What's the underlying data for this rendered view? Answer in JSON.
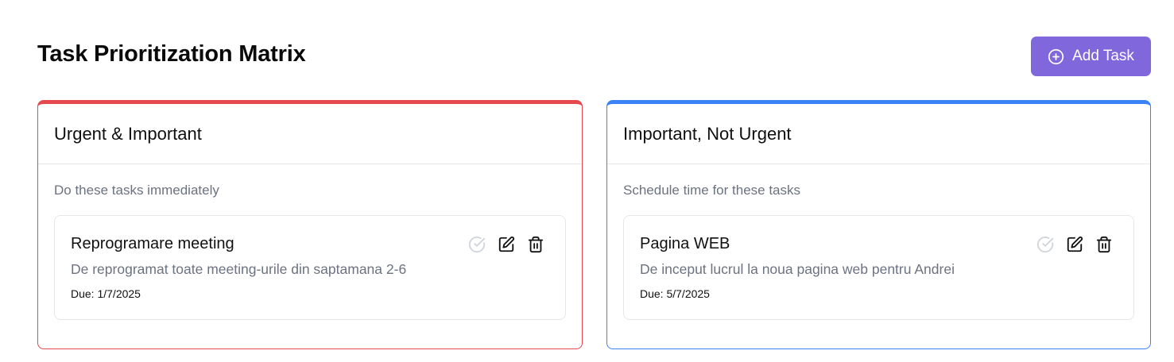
{
  "header": {
    "title": "Task Prioritization Matrix",
    "add_label": "Add Task"
  },
  "colors": {
    "accent": "#8067dc",
    "urgent_important": "#e5484d",
    "important_not_urgent": "#3b82f6"
  },
  "quadrants": [
    {
      "title": "Urgent & Important",
      "description": "Do these tasks immediately",
      "tasks": [
        {
          "title": "Reprogramare meeting",
          "description": "De reprogramat toate meeting-urile din saptamana 2-6",
          "due": "Due: 1/7/2025"
        }
      ]
    },
    {
      "title": "Important, Not Urgent",
      "description": "Schedule time for these tasks",
      "tasks": [
        {
          "title": "Pagina WEB",
          "description": "De inceput lucrul la noua pagina web pentru Andrei",
          "due": "Due: 5/7/2025"
        }
      ]
    }
  ],
  "icons": {
    "add": "plus-circle-icon",
    "complete": "check-circle-icon",
    "edit": "edit-icon",
    "delete": "trash-icon"
  }
}
